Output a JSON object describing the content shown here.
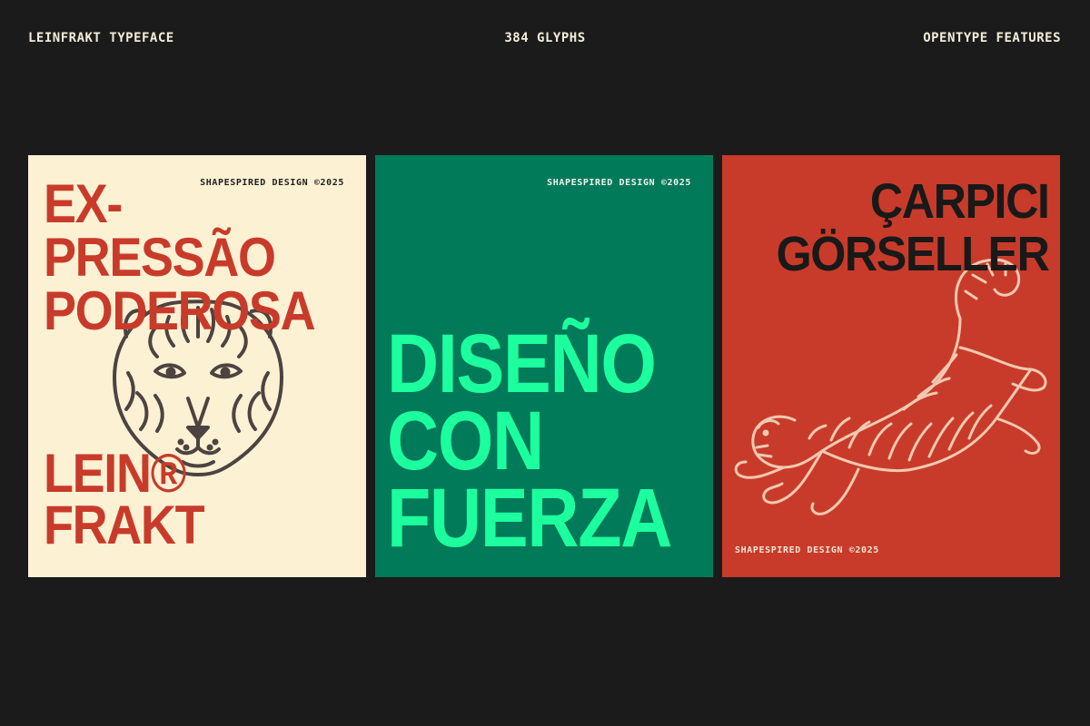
{
  "header": {
    "left": "LEINFRAKT TYPEFACE",
    "center": "384 GLYPHS",
    "right": "OPENTYPE FEATURES"
  },
  "posters": [
    {
      "background": "#fdf1d4",
      "text_color": "#c83b2a",
      "credit": "SHAPESPIRED DESIGN ©2025",
      "headline": [
        "EX-",
        "PRESSÃO",
        "PODEROSA"
      ],
      "name": [
        "LEIN",
        "FRAKT"
      ],
      "name_mark": "®",
      "illustration": "tiger-head-icon"
    },
    {
      "background": "#007a58",
      "text_color": "#1dff9e",
      "credit": "SHAPESPIRED DESIGN ©2025",
      "headline": [
        "DISEÑO",
        "CON",
        "FUERZA"
      ]
    },
    {
      "background": "#c83b2a",
      "text_color": "#191919",
      "credit": "SHAPESPIRED DESIGN ©2025",
      "headline": [
        "ÇARPICI",
        "GÖRSELLER"
      ],
      "illustration": "leaping-tiger-icon"
    }
  ]
}
